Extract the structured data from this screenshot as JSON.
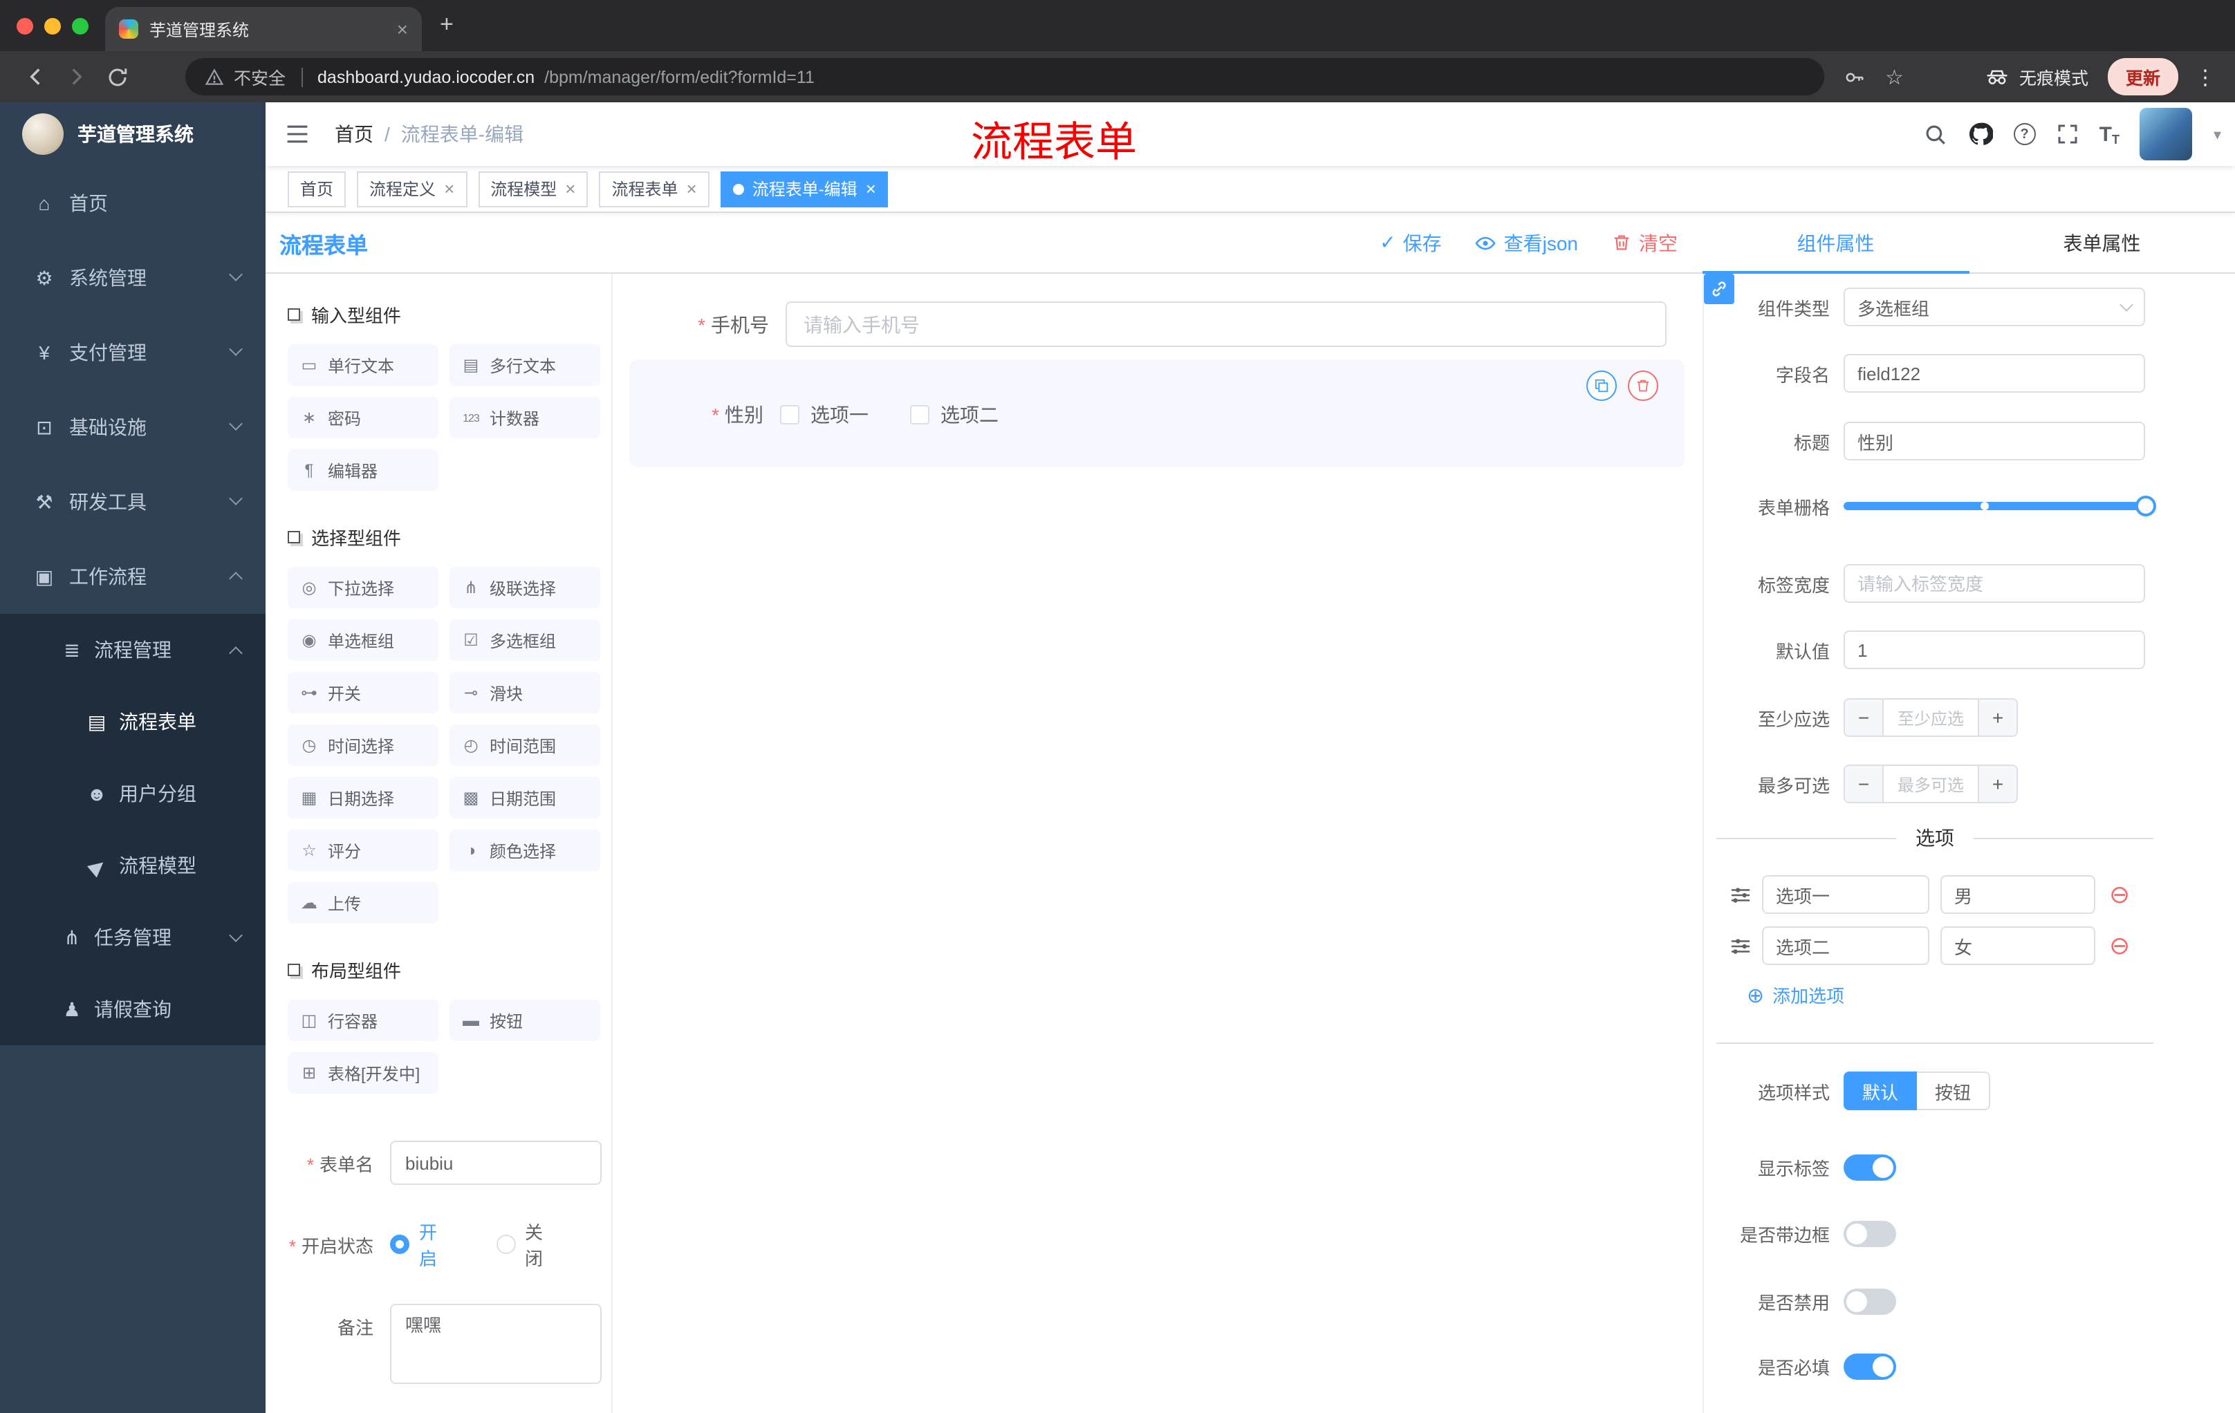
{
  "browser": {
    "tab_title": "芋道管理系统",
    "security_label": "不安全",
    "url_host": "dashboard.yudao.iocoder.cn",
    "url_path": "/bpm/manager/form/edit?formId=11",
    "incognito_label": "无痕模式",
    "update_label": "更新"
  },
  "icons": {
    "close": "×",
    "new_tab": "+",
    "kebab": "⋮",
    "star": "☆",
    "help": "?",
    "font_size": "T",
    "caret_down": "▾",
    "save_check": "✓",
    "add_circle": "⊕",
    "remove_circle": "⊖",
    "minus": "−",
    "plus": "+",
    "breadcrumb_sep": "/"
  },
  "sidebar": {
    "title": "芋道管理系统",
    "items": [
      {
        "glyph": "⌂",
        "label": "首页"
      },
      {
        "glyph": "⚙",
        "label": "系统管理"
      },
      {
        "glyph": "¥",
        "label": "支付管理"
      },
      {
        "glyph": "⊡",
        "label": "基础设施"
      },
      {
        "glyph": "⚒",
        "label": "研发工具"
      },
      {
        "glyph": "▣",
        "label": "工作流程"
      },
      {
        "glyph": "≣",
        "label": "流程管理"
      },
      {
        "glyph": "▤",
        "label": "流程表单"
      },
      {
        "glyph": "☻",
        "label": "用户分组"
      },
      {
        "glyph": "▶",
        "label": "流程模型"
      },
      {
        "glyph": "⋔",
        "label": "任务管理"
      },
      {
        "glyph": "♟",
        "label": "请假查询"
      }
    ]
  },
  "header": {
    "breadcrumb": [
      "首页",
      "流程表单-编辑"
    ],
    "annotation": "流程表单"
  },
  "tags": [
    {
      "label": "首页"
    },
    {
      "label": "流程定义"
    },
    {
      "label": "流程模型"
    },
    {
      "label": "流程表单"
    },
    {
      "label": "流程表单-编辑"
    }
  ],
  "designer": {
    "title": "流程表单",
    "actions": {
      "save": "保存",
      "view_json": "查看json",
      "clear": "清空"
    },
    "palette": {
      "groups": [
        {
          "title": "输入型组件",
          "items": [
            {
              "glyph": "▭",
              "label": "单行文本"
            },
            {
              "glyph": "▤",
              "label": "多行文本"
            },
            {
              "glyph": "∗",
              "label": "密码"
            },
            {
              "glyph": "123",
              "label": "计数器"
            },
            {
              "glyph": "¶",
              "label": "编辑器"
            }
          ]
        },
        {
          "title": "选择型组件",
          "items": [
            {
              "glyph": "◎",
              "label": "下拉选择"
            },
            {
              "glyph": "⋔",
              "label": "级联选择"
            },
            {
              "glyph": "◉",
              "label": "单选框组"
            },
            {
              "glyph": "☑",
              "label": "多选框组"
            },
            {
              "glyph": "⊶",
              "label": "开关"
            },
            {
              "glyph": "⊸",
              "label": "滑块"
            },
            {
              "glyph": "◷",
              "label": "时间选择"
            },
            {
              "glyph": "◴",
              "label": "时间范围"
            },
            {
              "glyph": "▦",
              "label": "日期选择"
            },
            {
              "glyph": "▩",
              "label": "日期范围"
            },
            {
              "glyph": "☆",
              "label": "评分"
            },
            {
              "glyph": "◑",
              "label": "颜色选择"
            },
            {
              "glyph": "☁",
              "label": "上传"
            }
          ]
        },
        {
          "title": "布局型组件",
          "items": [
            {
              "glyph": "◫",
              "label": "行容器"
            },
            {
              "glyph": "▬",
              "label": "按钮"
            },
            {
              "glyph": "⊞",
              "label": "表格[开发中]"
            }
          ]
        }
      ],
      "form": {
        "name_label": "表单名",
        "name_value": "biubiu",
        "status_label": "开启状态",
        "status_on": "开启",
        "status_off": "关闭",
        "remark_label": "备注",
        "remark_value": "嘿嘿"
      }
    },
    "canvas": {
      "phone_label": "手机号",
      "phone_placeholder": "请输入手机号",
      "gender_label": "性别",
      "gender_opt1": "选项一",
      "gender_opt2": "选项二"
    },
    "props": {
      "tab_component": "组件属性",
      "tab_form": "表单属性",
      "component_type_label": "组件类型",
      "component_type_value": "多选框组",
      "field_name_label": "字段名",
      "field_name_value": "field122",
      "title_label": "标题",
      "title_value": "性别",
      "grid_label": "表单栅格",
      "label_width_label": "标签宽度",
      "label_width_placeholder": "请输入标签宽度",
      "default_label": "默认值",
      "default_value": "1",
      "min_label": "至少应选",
      "min_placeholder": "至少应选",
      "max_label": "最多可选",
      "max_placeholder": "最多可选",
      "options_title": "选项",
      "options": [
        {
          "label": "选项一",
          "value": "男"
        },
        {
          "label": "选项二",
          "value": "女"
        }
      ],
      "add_option": "添加选项",
      "style_label": "选项样式",
      "style_default": "默认",
      "style_button": "按钮",
      "toggle_show_label": "显示标签",
      "toggle_border": "是否带边框",
      "toggle_disabled": "是否禁用",
      "toggle_required": "是否必填"
    }
  },
  "colors": {
    "primary": "#409EFF",
    "danger": "#F56C6C",
    "annotation": "#F80000",
    "sidebar": "#304156",
    "submenu": "#1F2D3D"
  }
}
